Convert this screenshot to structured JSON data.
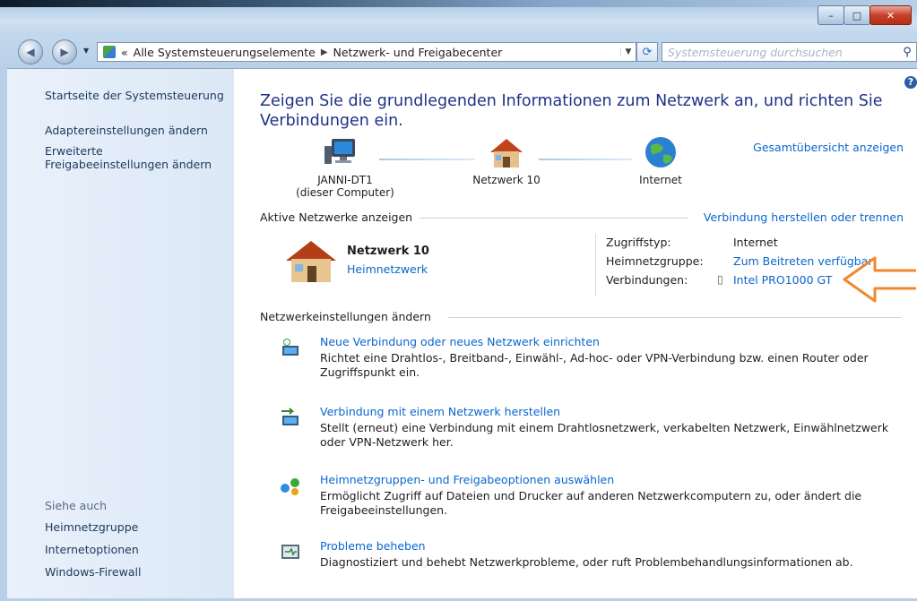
{
  "window": {
    "caption_minimize": "–",
    "caption_maximize": "□",
    "caption_close": "✕"
  },
  "nav": {
    "breadcrumb_prefix": "«",
    "breadcrumb": [
      "Alle Systemsteuerungselemente",
      "Netzwerk- und Freigabecenter"
    ],
    "search_placeholder": "Systemsteuerung durchsuchen"
  },
  "sidebar": {
    "items": [
      "Startseite der Systemsteuerung",
      "Adaptereinstellungen ändern",
      "Erweiterte",
      "Freigabeeinstellungen ändern"
    ],
    "see_also_label": "Siehe auch",
    "see_also": [
      "Heimnetzgruppe",
      "Internetoptionen",
      "Windows-Firewall"
    ]
  },
  "main": {
    "title_line1": "Zeigen Sie die grundlegenden Informationen zum Netzwerk an, und richten Sie",
    "title_line2": "Verbindungen ein.",
    "full_map_link": "Gesamtübersicht anzeigen",
    "map_nodes": [
      {
        "label": "JANNI-DT1",
        "sub": "(dieser Computer)"
      },
      {
        "label": "Netzwerk 10",
        "sub": ""
      },
      {
        "label": "Internet",
        "sub": ""
      }
    ],
    "active_networks_header": "Aktive Netzwerke anzeigen",
    "connect_link": "Verbindung herstellen oder trennen",
    "network": {
      "name": "Netzwerk 10",
      "type_link": "Heimnetzwerk",
      "access_type_label": "Zugriffstyp:",
      "access_type_value": "Internet",
      "homegroup_label": "Heimnetzgruppe:",
      "homegroup_value": "Zum Beitreten verfügbar",
      "connections_label": "Verbindungen:",
      "connections_value": "Intel PRO1000 GT"
    },
    "settings_header": "Netzwerkeinstellungen ändern",
    "tasks": [
      {
        "title": "Neue Verbindung oder neues Netzwerk einrichten",
        "desc": "Richtet eine Drahtlos-, Breitband-, Einwähl-, Ad-hoc- oder VPN-Verbindung bzw. einen Router oder Zugriffspunkt ein.",
        "icon": "network-setup-icon"
      },
      {
        "title": "Verbindung mit einem Netzwerk herstellen",
        "desc": "Stellt (erneut) eine Verbindung mit einem Drahtlosnetzwerk, verkabelten Netzwerk, Einwählnetzwerk oder VPN-Netzwerk her.",
        "icon": "connect-network-icon"
      },
      {
        "title": "Heimnetzgruppen- und Freigabeoptionen auswählen",
        "desc": "Ermöglicht Zugriff auf Dateien und Drucker auf anderen Netzwerkcomputern zu, oder ändert die Freigabeeinstellungen.",
        "icon": "homegroup-icon"
      },
      {
        "title": "Probleme beheben",
        "desc": "Diagnostiziert und behebt Netzwerkprobleme, oder ruft Problembehandlungsinformationen ab.",
        "icon": "troubleshoot-icon"
      }
    ]
  },
  "colors": {
    "link": "#0a66cc",
    "title": "#1e3287",
    "annotation_arrow": "#f0882f"
  }
}
